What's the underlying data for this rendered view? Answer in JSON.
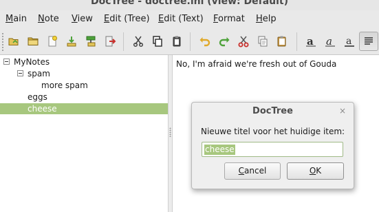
{
  "window": {
    "title": "DocTree - doctree.ini (view: Default)"
  },
  "menubar": {
    "items": [
      {
        "label": "Main"
      },
      {
        "label": "Note"
      },
      {
        "label": "View"
      },
      {
        "label": "Edit (Tree)"
      },
      {
        "label": "Edit (Text)"
      },
      {
        "label": "Format"
      },
      {
        "label": "Help"
      }
    ]
  },
  "toolbar": {
    "icons": [
      "open-folder-icon",
      "folder-icon",
      "new-note-icon",
      "import-icon",
      "move-node-icon",
      "exit-icon",
      "cut-icon",
      "copy-icon",
      "paste-icon",
      "undo-icon",
      "redo-icon",
      "cut-text-icon",
      "copy-text-icon",
      "paste-text-icon",
      "bold-icon",
      "italic-icon",
      "underline-icon",
      "align-icon"
    ],
    "active": "align-icon"
  },
  "tree": {
    "nodes": [
      {
        "label": "MyNotes",
        "level": 0,
        "expanded": true,
        "selected": false
      },
      {
        "label": "spam",
        "level": 1,
        "expanded": true,
        "selected": false
      },
      {
        "label": "more spam",
        "level": 2,
        "selected": false
      },
      {
        "label": "eggs",
        "level": 1,
        "selected": false
      },
      {
        "label": "cheese",
        "level": 1,
        "selected": true
      }
    ]
  },
  "editor": {
    "text": "No, I'm afraid we're fresh out of Gouda"
  },
  "dialog": {
    "title": "DocTree",
    "close_glyph": "×",
    "prompt": "Nieuwe titel voor het huidige item:",
    "input_value": "cheese",
    "cancel_label": "Cancel",
    "ok_label": "OK"
  },
  "colors": {
    "selection": "#a7c77e",
    "window_bg": "#e9e9e9",
    "icon_green": "#4ea23a",
    "icon_orange": "#e58a1d",
    "icon_red": "#c9302c"
  }
}
